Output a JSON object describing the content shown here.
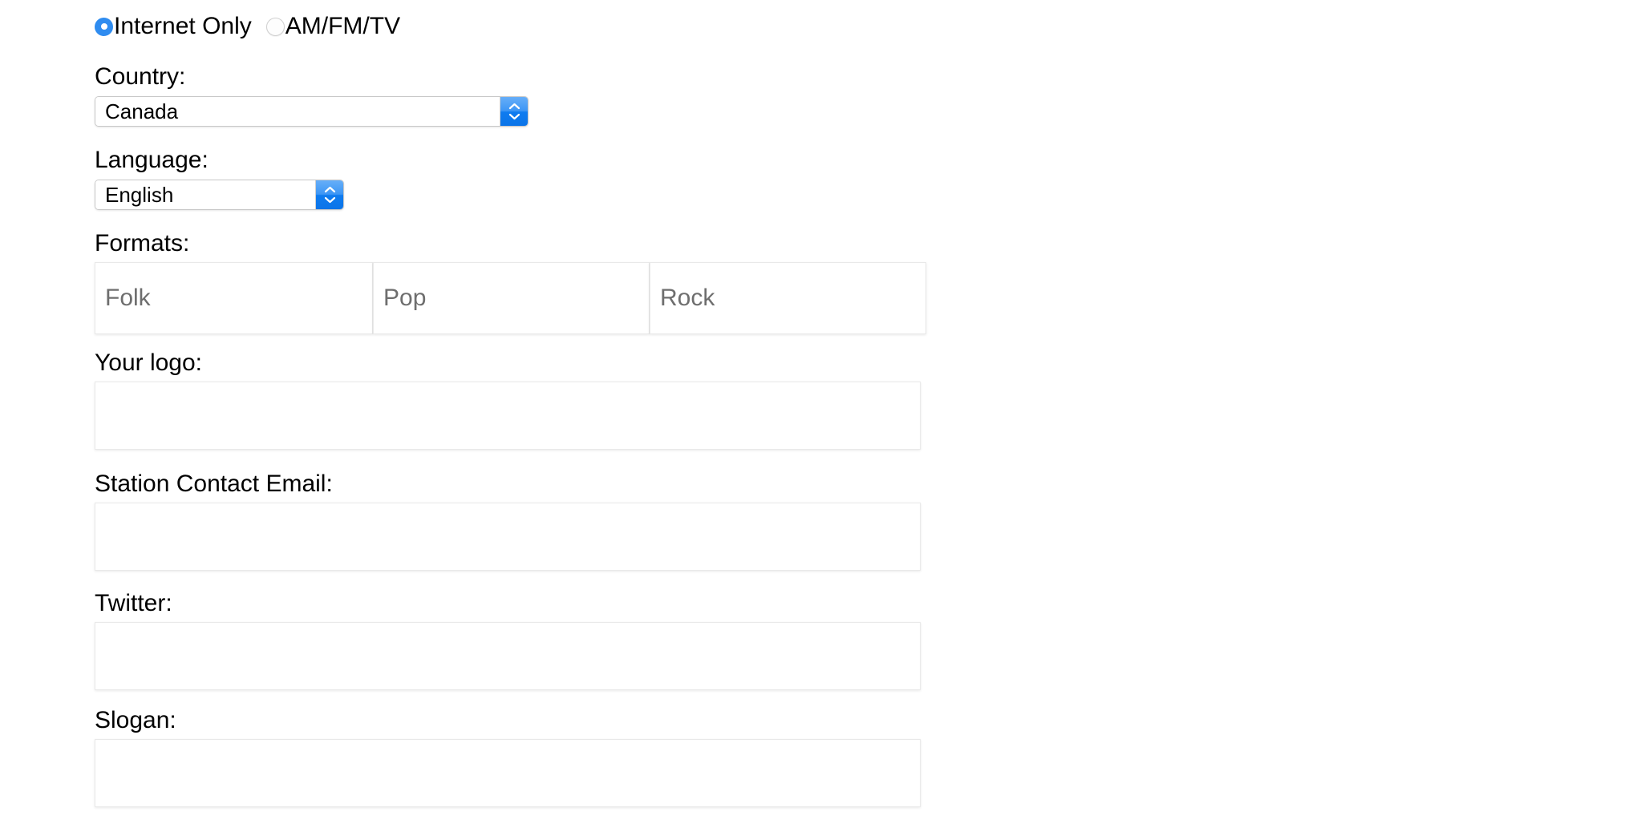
{
  "station_type": {
    "options": [
      {
        "label": "Internet Only",
        "selected": true
      },
      {
        "label": "AM/FM/TV",
        "selected": false
      }
    ]
  },
  "country": {
    "label": "Country:",
    "value": "Canada",
    "stepper_icon": "chevron-up-down-icon"
  },
  "language": {
    "label": "Language:",
    "value": "English",
    "stepper_icon": "chevron-up-down-icon"
  },
  "formats": {
    "label": "Formats:",
    "fields": [
      {
        "name": "format-1",
        "value": "",
        "placeholder": "Folk"
      },
      {
        "name": "format-2",
        "value": "",
        "placeholder": "Pop"
      },
      {
        "name": "format-3",
        "value": "",
        "placeholder": "Rock"
      }
    ]
  },
  "logo": {
    "label": "Your logo:",
    "value": "",
    "placeholder": ""
  },
  "contact_email": {
    "label": "Station Contact Email:",
    "value": "",
    "placeholder": ""
  },
  "twitter": {
    "label": "Twitter:",
    "value": "",
    "placeholder": ""
  },
  "slogan": {
    "label": "Slogan:",
    "value": "",
    "placeholder": ""
  },
  "colors": {
    "accent_blue": "#2f8cf0",
    "stepper_blue_top": "#66aef8",
    "stepper_blue_bottom": "#0b74e8",
    "placeholder_gray": "#6e6e6e",
    "box_border": "#e9e9e9",
    "select_border": "#c8c8c8",
    "text": "#000000",
    "background": "#ffffff"
  }
}
